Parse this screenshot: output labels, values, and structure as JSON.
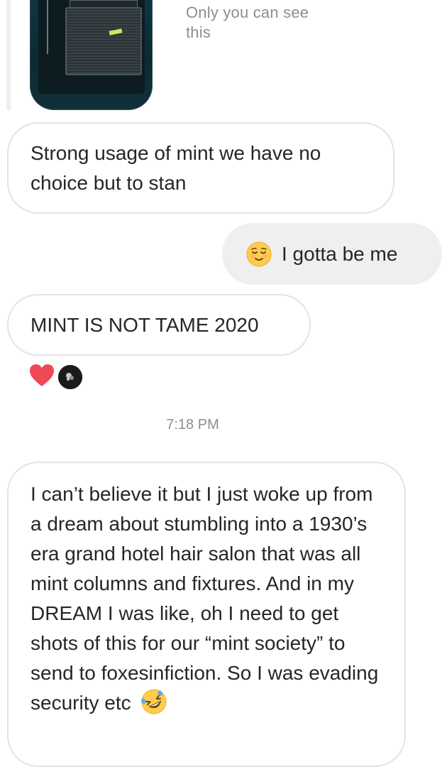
{
  "shared_post": {
    "note": "Only you can see this"
  },
  "messages": [
    {
      "id": "m1",
      "side": "received",
      "text": "Strong usage of mint we have no choice but to stan"
    },
    {
      "id": "m2",
      "side": "sent",
      "emoji": "relieved-face-emoji",
      "text": "I gotta be me"
    },
    {
      "id": "m3",
      "side": "received",
      "text": "MINT IS NOT TAME 2020",
      "reactions": [
        "red-heart-icon",
        "user-avatar"
      ]
    },
    {
      "id": "m4",
      "side": "received",
      "text": "I can’t believe it but I just woke up from a dream about stumbling into a 1930’s era grand hotel hair salon that was all mint columns and fixtures. And in my DREAM I was like, oh I need to get shots of this for our “mint society” to send to foxesinfiction. So I was evading security etc",
      "emoji": "rolling-on-floor-laughing-emoji"
    }
  ],
  "timestamp": "7:18 PM",
  "colors": {
    "bubble_border": "#e3e3e3",
    "sent_bubble": "#efefef",
    "text": "#262626",
    "muted_text": "#8e8e8e",
    "heart": "#ed4956"
  }
}
